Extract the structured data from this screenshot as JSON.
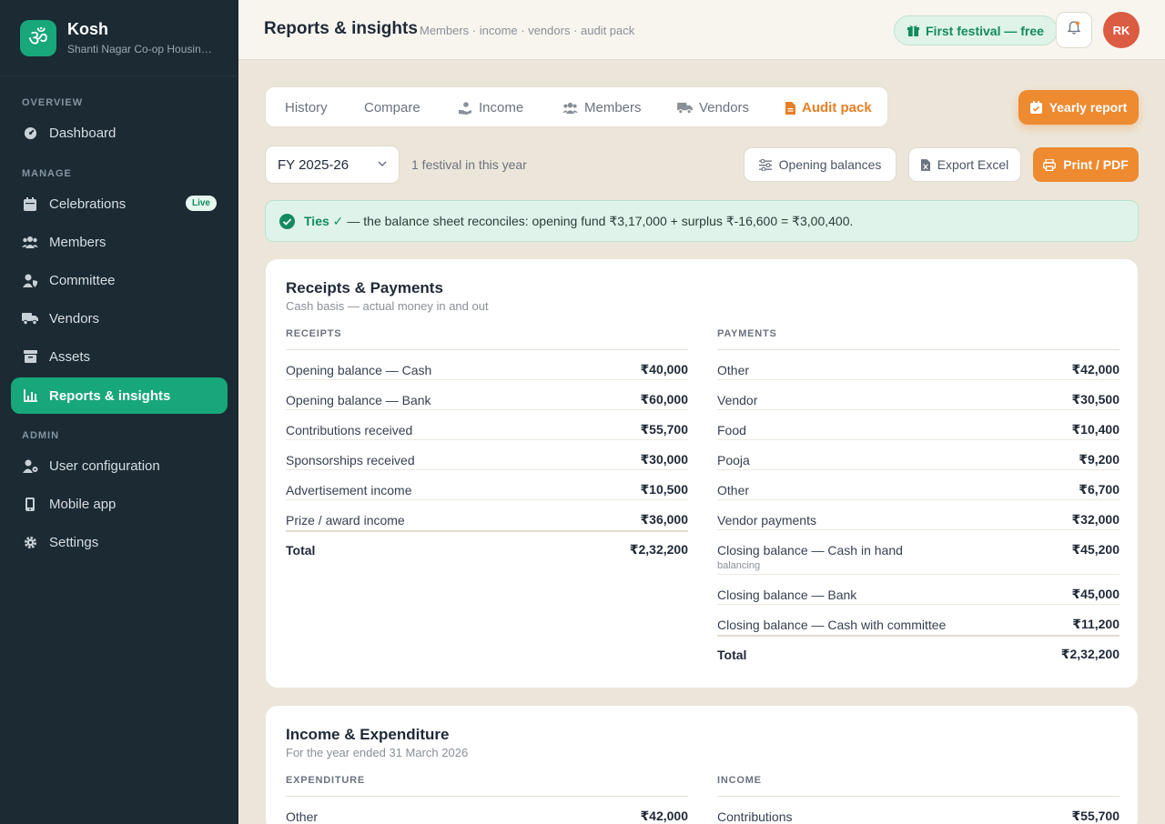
{
  "brand": {
    "name": "Kosh",
    "subtitle": "Shanti Nagar Co-op Housing Society",
    "logo_glyph": "ॐ"
  },
  "sidebar": {
    "sections": {
      "overview": "OVERVIEW",
      "manage": "MANAGE",
      "admin": "ADMIN"
    },
    "items": [
      {
        "label": "Dashboard",
        "icon": "gauge-icon"
      },
      {
        "label": "Celebrations",
        "icon": "calendar-icon",
        "badge": "Live"
      },
      {
        "label": "Members",
        "icon": "users-icon"
      },
      {
        "label": "Committee",
        "icon": "user-shield-icon"
      },
      {
        "label": "Vendors",
        "icon": "truck-icon"
      },
      {
        "label": "Assets",
        "icon": "archive-icon"
      },
      {
        "label": "Reports & insights",
        "icon": "chart-icon",
        "active": true
      },
      {
        "label": "User configuration",
        "icon": "user-gear-icon"
      },
      {
        "label": "Mobile app",
        "icon": "mobile-icon"
      },
      {
        "label": "Settings",
        "icon": "gear-icon"
      }
    ]
  },
  "header": {
    "title": "Reports & insights",
    "subtitle": "Members · income · vendors · audit pack",
    "promo": "First festival — free",
    "avatar": "RK"
  },
  "tabs": [
    {
      "label": "History"
    },
    {
      "label": "Compare"
    },
    {
      "label": "Income",
      "icon": "hand-coin-icon"
    },
    {
      "label": "Members",
      "icon": "users-icon"
    },
    {
      "label": "Vendors",
      "icon": "truck-icon"
    },
    {
      "label": "Audit pack",
      "icon": "file-icon",
      "active": true
    }
  ],
  "yearly_button": "Yearly report",
  "filters": {
    "fy": "FY 2025-26",
    "note": "1 festival in this year",
    "opening_balances": "Opening balances",
    "export_excel": "Export Excel",
    "print_pdf": "Print / PDF"
  },
  "alert": {
    "strong": "Ties ✓",
    "text": "— the balance sheet reconciles: opening fund ₹3,17,000 + surplus ₹-16,600 = ₹3,00,400."
  },
  "rp": {
    "title": "Receipts & Payments",
    "subtitle": "Cash basis — actual money in and out",
    "receipts_head": "RECEIPTS",
    "payments_head": "PAYMENTS",
    "receipts": [
      {
        "label": "Opening balance — Cash",
        "amount": "₹40,000"
      },
      {
        "label": "Opening balance — Bank",
        "amount": "₹60,000"
      },
      {
        "label": "Contributions received",
        "amount": "₹55,700"
      },
      {
        "label": "Sponsorships received",
        "amount": "₹30,000"
      },
      {
        "label": "Advertisement income",
        "amount": "₹10,500"
      },
      {
        "label": "Prize / award income",
        "amount": "₹36,000"
      }
    ],
    "receipts_total": {
      "label": "Total",
      "amount": "₹2,32,200"
    },
    "payments": [
      {
        "label": "Other",
        "amount": "₹42,000"
      },
      {
        "label": "Vendor",
        "amount": "₹30,500"
      },
      {
        "label": "Food",
        "amount": "₹10,400"
      },
      {
        "label": "Pooja",
        "amount": "₹9,200"
      },
      {
        "label": "Other",
        "amount": "₹6,700"
      },
      {
        "label": "Vendor payments",
        "amount": "₹32,000"
      },
      {
        "label": "Closing balance — Cash in hand",
        "amount": "₹45,200",
        "note": "balancing"
      },
      {
        "label": "Closing balance — Bank",
        "amount": "₹45,000"
      },
      {
        "label": "Closing balance — Cash with committee",
        "amount": "₹11,200"
      }
    ],
    "payments_total": {
      "label": "Total",
      "amount": "₹2,32,200"
    }
  },
  "ie": {
    "title": "Income & Expenditure",
    "subtitle": "For the year ended 31 March 2026",
    "expenditure_head": "EXPENDITURE",
    "income_head": "INCOME",
    "expenditure": [
      {
        "label": "Other",
        "amount": "₹42,000"
      }
    ],
    "income": [
      {
        "label": "Contributions",
        "amount": "₹55,700"
      }
    ]
  }
}
